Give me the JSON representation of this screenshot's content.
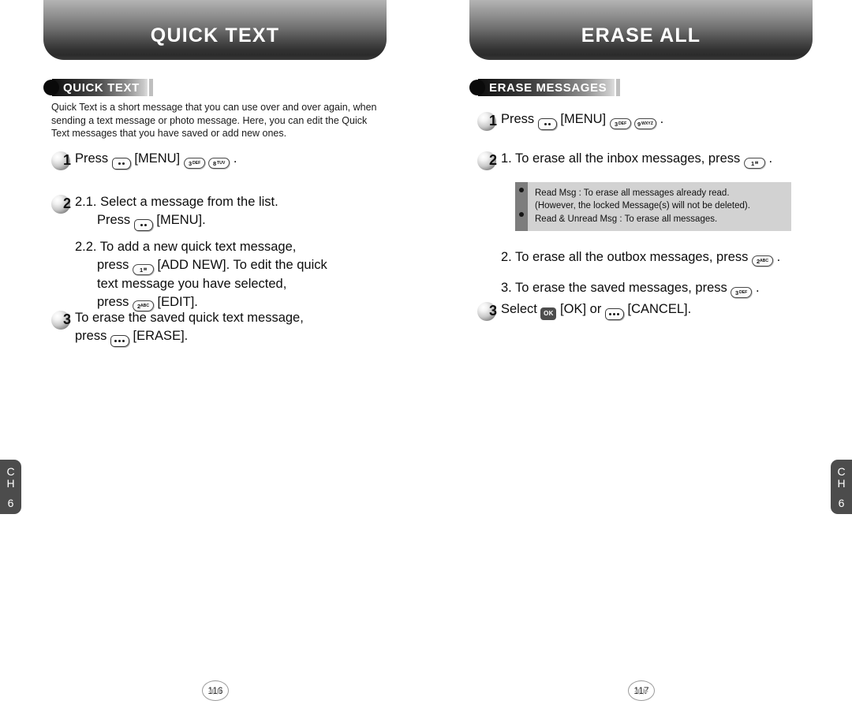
{
  "left_page": {
    "title": "QUICK TEXT",
    "section_label": "QUICK TEXT",
    "intro": "Quick Text is a short message that you can use over and over again, when sending a text message or photo message.  Here, you can edit the Quick Text messages that you have saved or add new ones.",
    "steps": [
      {
        "number": "1",
        "line1_a": "Press",
        "line1_b": "[MENU]",
        "line1_c": "."
      },
      {
        "number": "2",
        "l1": "2.1. Select a message from the list.",
        "l2_a": "Press",
        "l2_b": "[MENU].",
        "l3": "2.2. To add a new quick text message,",
        "l4_a": "press",
        "l4_b": "[ADD NEW]. To edit the quick",
        "l5": "text message you have selected,",
        "l6_a": "press",
        "l6_b": "[EDIT]."
      },
      {
        "number": "3",
        "l1": "To erase the saved quick text message,",
        "l2_a": "press",
        "l2_b": "[ERASE]."
      }
    ],
    "keys": {
      "menu": "menu-softkey",
      "three": {
        "digit": "3",
        "letters": "DEF"
      },
      "eight": {
        "digit": "8",
        "letters": "TUV"
      },
      "one": {
        "digit": "1",
        "letters": "✉"
      },
      "two": {
        "digit": "2",
        "letters": "ABC"
      },
      "erase": "erase-softkey"
    },
    "page_number": "116",
    "chapter_tab": {
      "c": "C",
      "h": "H",
      "num": "6"
    }
  },
  "right_page": {
    "title": "ERASE ALL",
    "section_label": "ERASE MESSAGES",
    "steps": [
      {
        "number": "1",
        "l1_a": "Press",
        "l1_b": "[MENU]",
        "l1_c": "."
      },
      {
        "number": "2",
        "l1_a": "1. To erase all the inbox messages, press",
        "l1_b": ".",
        "l2_a": "2. To erase all the outbox messages, press",
        "l2_b": ".",
        "l3_a": "3. To erase the saved messages, press",
        "l3_b": "."
      },
      {
        "number": "3",
        "l1_a": "Select",
        "l1_b": "[OK] or",
        "l1_c": "[CANCEL]."
      }
    ],
    "note_box": {
      "line1": "Read Msg : To erase all messages already read.",
      "line2": "(However, the locked Message(s) will not be deleted).",
      "line3": "Read & Unread Msg : To erase all messages."
    },
    "keys": {
      "menu": "menu-softkey",
      "three": {
        "digit": "3",
        "letters": "DEF"
      },
      "nine": {
        "digit": "9",
        "letters": "WXYZ"
      },
      "one": {
        "digit": "1",
        "letters": "✉"
      },
      "two": {
        "digit": "2",
        "letters": "ABC"
      },
      "ok": "OK",
      "cancel": "cancel-softkey"
    },
    "page_number": "117",
    "chapter_tab": {
      "c": "C",
      "h": "H",
      "num": "6"
    }
  },
  "colors": {
    "title_bar_dark": "#2b2b2b",
    "title_bar_light": "#b4b4b4",
    "note_box_bg": "#d2d2d2",
    "note_rail": "#7d7d7d",
    "side_tab": "#4c4c4c"
  }
}
